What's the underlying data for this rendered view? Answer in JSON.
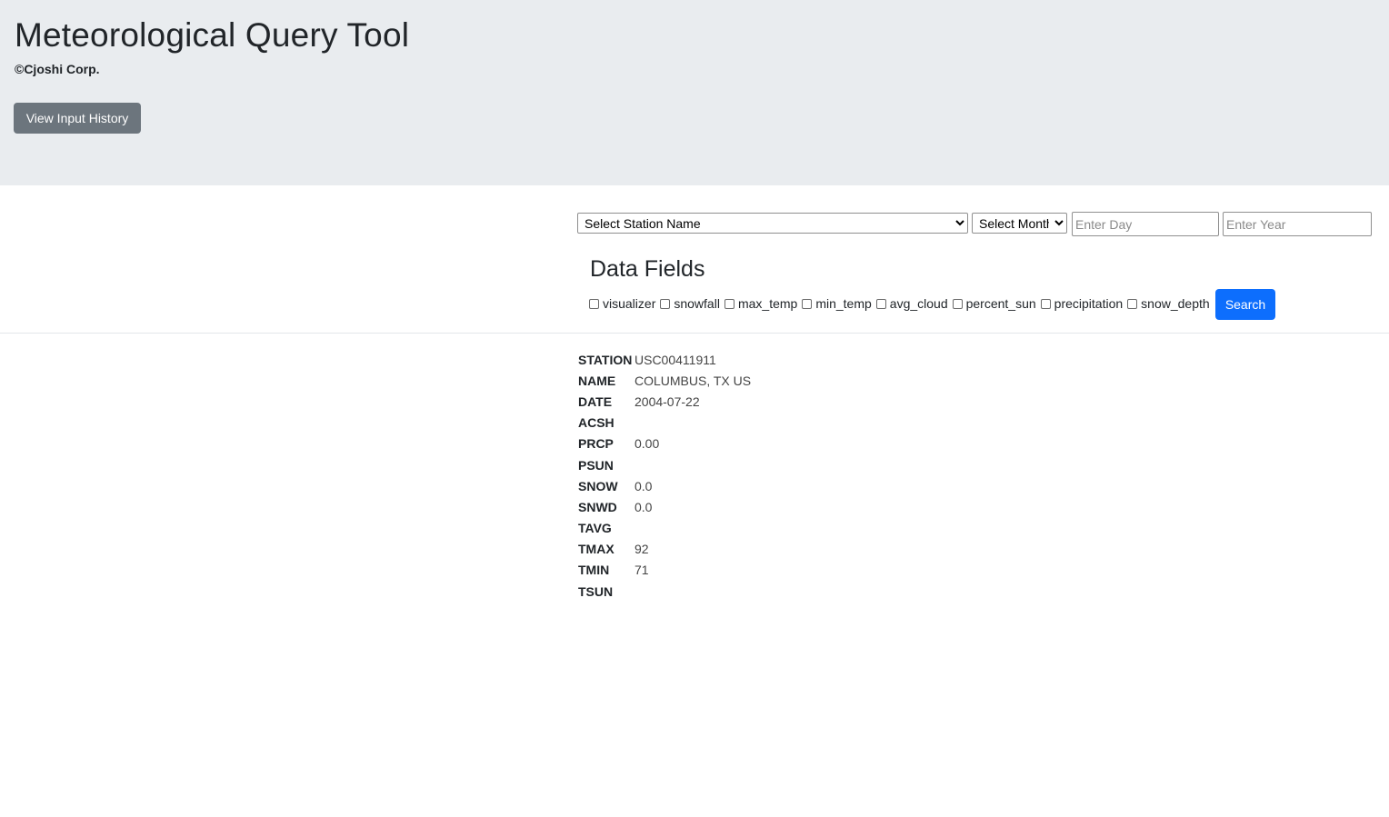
{
  "header": {
    "title": "Meteorological Query Tool",
    "copyright": "©Cjoshi Corp.",
    "history_button": "View Input History"
  },
  "form": {
    "station_select": {
      "selected": "Select Station Name"
    },
    "month_select": {
      "selected": "Select Month"
    },
    "day_input": {
      "value": "",
      "placeholder": "Enter Day"
    },
    "year_input": {
      "value": "",
      "placeholder": "Enter Year"
    }
  },
  "data_fields": {
    "heading": "Data Fields",
    "options": [
      {
        "label": "visualizer",
        "checked": false
      },
      {
        "label": "snowfall",
        "checked": false
      },
      {
        "label": "max_temp",
        "checked": false
      },
      {
        "label": "min_temp",
        "checked": false
      },
      {
        "label": "avg_cloud",
        "checked": false
      },
      {
        "label": "percent_sun",
        "checked": false
      },
      {
        "label": "precipitation",
        "checked": false
      },
      {
        "label": "snow_depth",
        "checked": false
      }
    ],
    "search_button": "Search"
  },
  "result": [
    {
      "key": "STATION",
      "value": "USC00411911"
    },
    {
      "key": "NAME",
      "value": "COLUMBUS, TX US"
    },
    {
      "key": "DATE",
      "value": "2004-07-22"
    },
    {
      "key": "ACSH",
      "value": ""
    },
    {
      "key": "PRCP",
      "value": "0.00"
    },
    {
      "key": "PSUN",
      "value": ""
    },
    {
      "key": "SNOW",
      "value": "0.0"
    },
    {
      "key": "SNWD",
      "value": "0.0"
    },
    {
      "key": "TAVG",
      "value": ""
    },
    {
      "key": "TMAX",
      "value": "92"
    },
    {
      "key": "TMIN",
      "value": "71"
    },
    {
      "key": "TSUN",
      "value": ""
    }
  ],
  "colors": {
    "header_bg": "#e9ecef",
    "secondary_button": "#6c757d",
    "primary_button": "#0d6efd"
  }
}
